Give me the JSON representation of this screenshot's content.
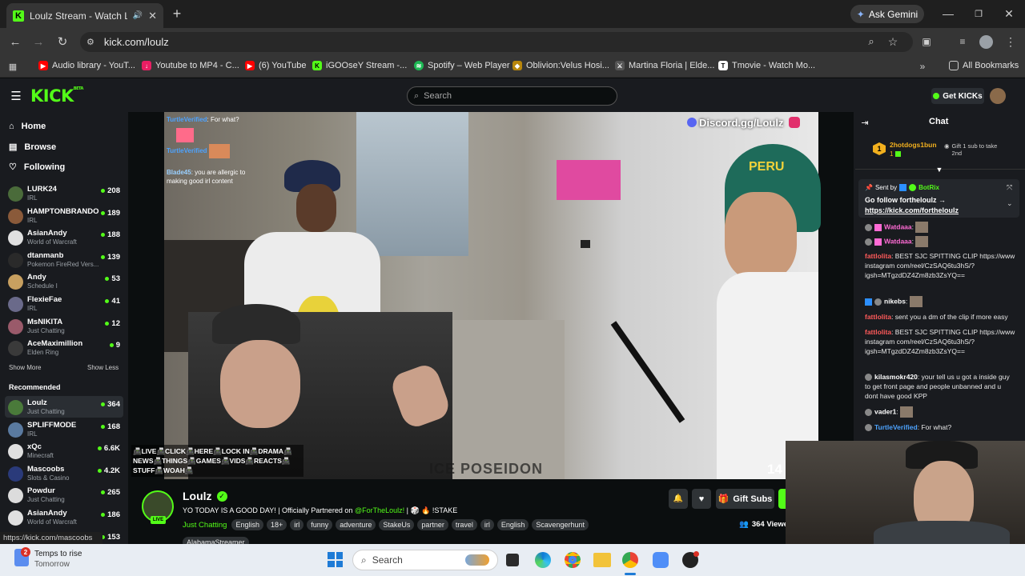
{
  "browser": {
    "tab_title": "Loulz Stream - Watch Live o",
    "url": "kick.com/loulz",
    "gemini_label": "Ask Gemini",
    "bookmarks": [
      {
        "label": "Audio library - YouT..."
      },
      {
        "label": "Youtube to MP4 - C..."
      },
      {
        "label": "(6) YouTube"
      },
      {
        "label": "iGOOseY Stream -..."
      },
      {
        "label": "Spotify – Web Player"
      },
      {
        "label": "Oblivion:Velus Hosi..."
      },
      {
        "label": "Martina Floria | Elde..."
      },
      {
        "label": "Tmovie - Watch Mo..."
      }
    ],
    "all_bookmarks_label": "All Bookmarks",
    "status_url": "https://kick.com/mascoobs"
  },
  "header": {
    "logo": "KICK",
    "logo_badge": "BETA",
    "search_placeholder": "Search",
    "get_kicks_label": "Get KICKs"
  },
  "sidebar": {
    "nav": [
      {
        "label": "Home"
      },
      {
        "label": "Browse"
      },
      {
        "label": "Following"
      }
    ],
    "following": [
      {
        "name": "LURK24",
        "category": "IRL",
        "viewers": "208",
        "color": "#4a6b3a"
      },
      {
        "name": "HAMPTONBRANDO",
        "category": "IRL",
        "viewers": "189",
        "color": "#8a5a3a"
      },
      {
        "name": "AsianAndy",
        "category": "World of Warcraft",
        "viewers": "188",
        "color": "#e0e0e0"
      },
      {
        "name": "dtanmanb",
        "category": "Pokemon FireRed Vers...",
        "viewers": "139",
        "color": "#2a2a2a"
      },
      {
        "name": "Andy",
        "category": "Schedule I",
        "viewers": "53",
        "color": "#c8a060"
      },
      {
        "name": "FlexieFae",
        "category": "IRL",
        "viewers": "41",
        "color": "#6a6a8a"
      },
      {
        "name": "MsNIKITA",
        "category": "Just Chatting",
        "viewers": "12",
        "color": "#9a5a6a"
      },
      {
        "name": "AceMaximillion",
        "category": "Elden Ring",
        "viewers": "9",
        "color": "#3a3a3a"
      }
    ],
    "show_more": "Show More",
    "show_less": "Show Less",
    "recommended_title": "Recommended",
    "recommended": [
      {
        "name": "Loulz",
        "category": "Just Chatting",
        "viewers": "364",
        "color": "#4a7a3a"
      },
      {
        "name": "SPLIFFMODE",
        "category": "IRL",
        "viewers": "168",
        "color": "#5a7aa0"
      },
      {
        "name": "xQc",
        "category": "Minecraft",
        "viewers": "6.6K",
        "color": "#e0e0e0"
      },
      {
        "name": "Mascoobs",
        "category": "Slots & Casino",
        "viewers": "4.2K",
        "color": "#2a3a7a"
      },
      {
        "name": "Powdur",
        "category": "Just Chatting",
        "viewers": "265",
        "color": "#dcdcdc"
      },
      {
        "name": "AsianAndy",
        "category": "World of Warcraft",
        "viewers": "186",
        "color": "#e0e0e0"
      },
      {
        "name": "",
        "category": "",
        "viewers": "153",
        "color": "#555555"
      }
    ]
  },
  "video": {
    "overlay_chat": [
      {
        "user": "TurtleVerified",
        "text": "For what?"
      },
      {
        "user": "TurtleVerified",
        "text": ""
      },
      {
        "user": "Blade45",
        "text": "you are allergic to making good irl content"
      }
    ],
    "discord_label": "Discord.gg/Loulz",
    "hat_text": "PERU",
    "title_overlay": "📠LIVE📠CLICK📠HERE📠LOCK IN📠DRAMA📠 NEWS📠THINGS📠GAMES📠VIDS📠REACTS📠 STUFF📠WOAH📠",
    "viewer_corner": "14",
    "bottom_watermark": "ICE POSEIDON"
  },
  "stream": {
    "streamer": "Loulz",
    "live_badge": "LIVE",
    "title_prefix": "YO TODAY IS A GOOD DAY! | Officially Partnered on ",
    "title_link": "@ForTheLoulz!",
    "title_suffix": " | 🎲 🔥 !STAKE",
    "category": "Just Chatting",
    "tags": [
      "English",
      "18+",
      "irl",
      "funny",
      "adventure",
      "StakeUs",
      "partner",
      "travel",
      "irl",
      "English",
      "Scavengerhunt"
    ],
    "tag_extra": "AlabamaStreamer",
    "gift_subs_label": "Gift Subs",
    "viewers_label": "364 Viewe"
  },
  "chat": {
    "title": "Chat",
    "top_gifter_rank": "1",
    "top_gifter_name": "2hotdogs1bun",
    "top_gifter_count": "1",
    "gift_prompt": "Gift 1 sub to take 2nd",
    "pinned_sent_by": "Sent by",
    "pinned_user": "BotRix",
    "pinned_text": "Go follow fortheloulz →",
    "pinned_link": "https://kick.com/fortheloulz",
    "messages": [
      {
        "user": "Watdaaa",
        "color": "#ff6bd5",
        "text": ""
      },
      {
        "user": "Watdaaa",
        "color": "#ff6bd5",
        "text": ""
      },
      {
        "user": "fattlolita",
        "color": "#ff5a5a",
        "text": "BEST SJC SPITTING CLIP https://www instagram com/reel/CzSAQ6tu3hS/? igsh=MTgzdDZ4Zm8zb3ZsYQ=="
      },
      {
        "user": "nikebs",
        "color": "#ffffff",
        "text": ""
      },
      {
        "user": "fattlolita",
        "color": "#ff5a5a",
        "text": "sent you a dm of the clip if more easy"
      },
      {
        "user": "fattlolita",
        "color": "#ff5a5a",
        "text": "BEST SJC SPITTING CLIP https://www instagram com/reel/CzSAQ6tu3hS/? igsh=MTgzdDZ4Zm8zb3ZsYQ=="
      },
      {
        "user": "kilasmokr420",
        "color": "#ffffff",
        "text": "your tell us u got a inside guy to get front page and people unbanned and u dont have good KPP"
      },
      {
        "user": "vader1",
        "color": "#ffffff",
        "text": ""
      },
      {
        "user": "TurtleVerified",
        "color": "#4da3ff",
        "text": "For what?"
      }
    ]
  },
  "taskbar": {
    "weather_title": "Temps to rise",
    "weather_sub": "Tomorrow",
    "weather_badge": "2",
    "search_label": "Search"
  }
}
